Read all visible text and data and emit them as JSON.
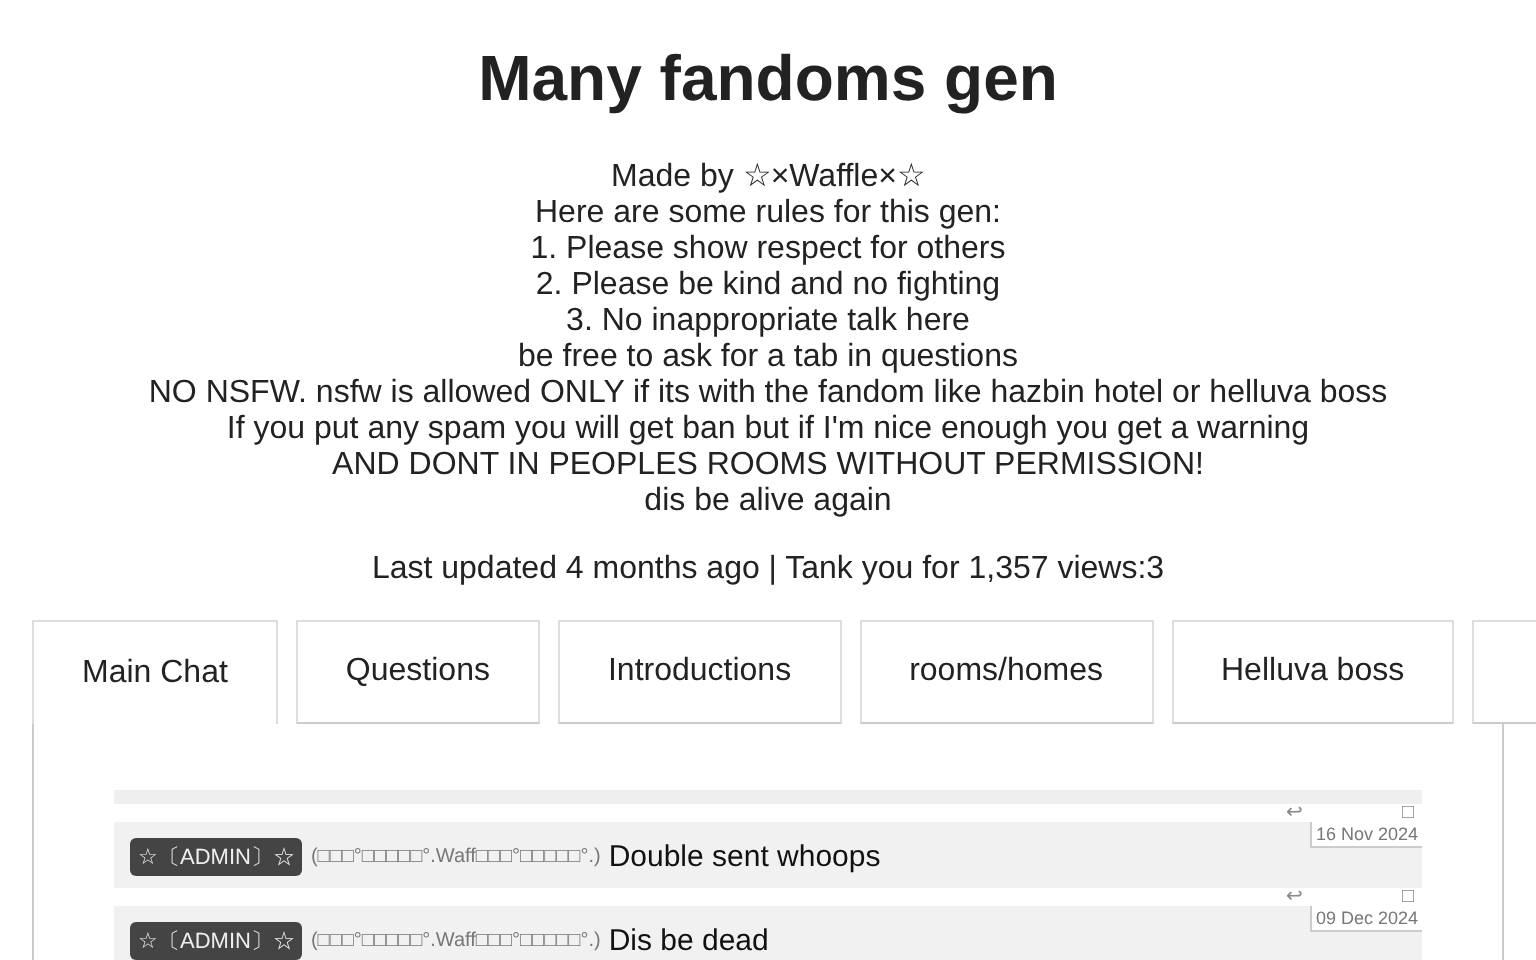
{
  "title": "Many fandoms gen",
  "intro": [
    "Made by ☆×Waffle×☆",
    "Here are some rules for this gen:",
    "1. Please show respect for others",
    "2. Please be kind and no fighting",
    "3. No inappropriate talk here",
    "be free to ask for a tab in questions",
    "NO NSFW. nsfw is allowed ONLY if its with the fandom like hazbin hotel or helluva boss",
    "If you put any spam you will get ban but if I'm nice enough you get a warning",
    "AND DONT IN PEOPLES ROOMS WITHOUT PERMISSION!",
    "dis be alive again"
  ],
  "updated": "Last updated 4 months ago | Tank you for 1,357 views:3",
  "tabs": [
    {
      "label": "Main Chat",
      "selected": true
    },
    {
      "label": "Questions",
      "selected": false
    },
    {
      "label": "Introductions",
      "selected": false
    },
    {
      "label": "rooms/homes",
      "selected": false
    },
    {
      "label": "Helluva boss",
      "selected": false
    },
    {
      "selected": false
    }
  ],
  "messages": [
    {
      "badge": "☆〔ADMIN〕☆",
      "user": "(□□□°□□□□□°.Waff□□□°□□□□□°.)",
      "text": "Double sent whoops",
      "date": "16 Nov 2024",
      "reply": "↩",
      "mark": "□"
    },
    {
      "badge": "☆〔ADMIN〕☆",
      "user": "(□□□°□□□□□°.Waff□□□°□□□□□°.)",
      "text": "Dis be dead",
      "date": "09 Dec 2024",
      "reply": "↩",
      "mark": "□"
    }
  ]
}
